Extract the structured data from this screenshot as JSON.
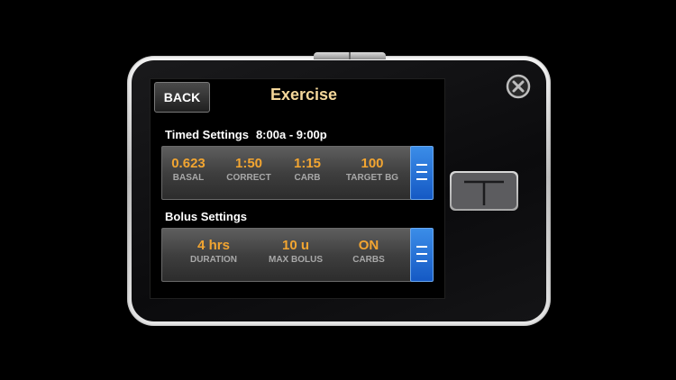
{
  "screen": {
    "back_label": "BACK",
    "title": "Exercise"
  },
  "timed": {
    "label": "Timed Settings",
    "range": "8:00a - 9:00p",
    "items": [
      {
        "value": "0.623",
        "label": "BASAL"
      },
      {
        "value": "1:50",
        "label": "CORRECT"
      },
      {
        "value": "1:15",
        "label": "CARB"
      },
      {
        "value": "100",
        "label": "TARGET BG"
      }
    ]
  },
  "bolus": {
    "label": "Bolus Settings",
    "items": [
      {
        "value": "4 hrs",
        "label": "DURATION"
      },
      {
        "value": "10 u",
        "label": "MAX BOLUS"
      },
      {
        "value": "ON",
        "label": "CARBS"
      }
    ]
  },
  "colors": {
    "title": "#f4d79a",
    "value": "#f2a531",
    "menu_button": "#1f6fd6"
  },
  "icons": {
    "close": "circle-x-icon",
    "menu": "hamburger-menu-icon",
    "logo": "t-logo-icon"
  }
}
